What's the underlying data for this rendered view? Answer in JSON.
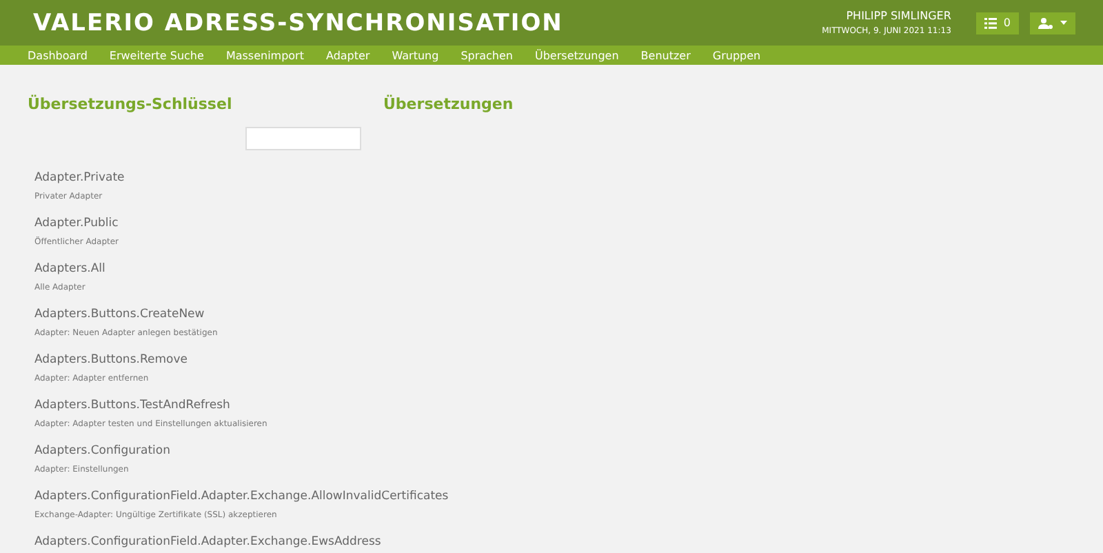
{
  "header": {
    "title": "VALERIO ADRESS-SYNCHRONISATION",
    "user": "PHILIPP SIMLINGER",
    "date": "MITTWOCH, 9. JUNI 2021 11:13",
    "task_count": "0"
  },
  "nav": [
    "Dashboard",
    "Erweiterte Suche",
    "Massenimport",
    "Adapter",
    "Wartung",
    "Sprachen",
    "Übersetzungen",
    "Benutzer",
    "Gruppen"
  ],
  "keys_panel": {
    "title": "Übersetzungs-Schlüssel",
    "items": [
      {
        "key": "Adapter.Private",
        "text": "Privater Adapter"
      },
      {
        "key": "Adapter.Public",
        "text": "Öffentlicher Adapter"
      },
      {
        "key": "Adapters.All",
        "text": "Alle Adapter"
      },
      {
        "key": "Adapters.Buttons.CreateNew",
        "text": "Adapter: Neuen Adapter anlegen bestätigen"
      },
      {
        "key": "Adapters.Buttons.Remove",
        "text": "Adapter: Adapter entfernen"
      },
      {
        "key": "Adapters.Buttons.TestAndRefresh",
        "text": "Adapter: Adapter testen und Einstellungen aktualisieren"
      },
      {
        "key": "Adapters.Configuration",
        "text": "Adapter: Einstellungen"
      },
      {
        "key": "Adapters.ConfigurationField.Adapter.Exchange.AllowInvalidCertificates",
        "text": "Exchange-Adapter: Ungültige Zertifikate (SSL) akzeptieren"
      },
      {
        "key": "Adapters.ConfigurationField.Adapter.Exchange.EwsAddress"
      }
    ]
  },
  "translations_panel": {
    "title": "Übersetzungen"
  }
}
